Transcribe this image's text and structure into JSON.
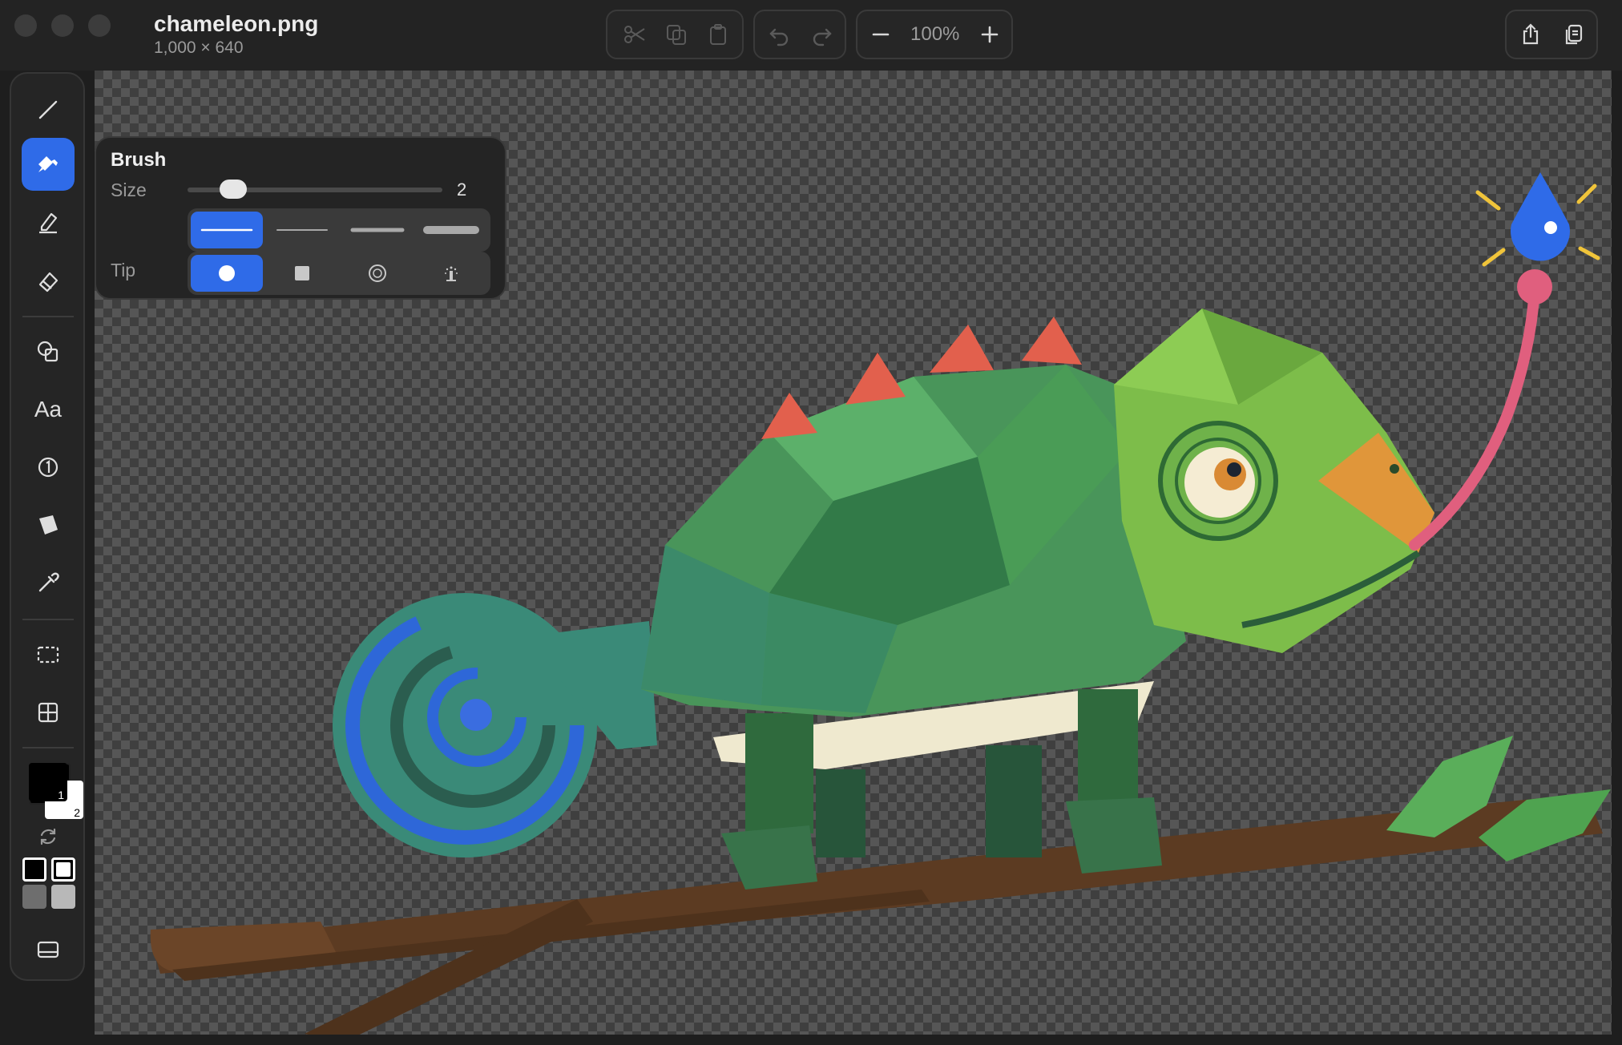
{
  "window": {
    "title": "chameleon.png",
    "dimensions": "1,000 × 640"
  },
  "toolbar_top": {
    "zoom_level": "100%",
    "icons": [
      "scissors-icon",
      "copy-icon",
      "paste-icon",
      "undo-icon",
      "redo-icon",
      "zoom-out-icon",
      "zoom-in-icon",
      "share-icon",
      "duplicate-icon"
    ]
  },
  "tools": {
    "items": [
      "pen",
      "brush",
      "highlighter",
      "eraser",
      "shapes",
      "text",
      "number",
      "fill",
      "eyedropper",
      "select",
      "grid"
    ],
    "active": "brush",
    "text_tool_label": "Aa",
    "number_tool_label": "1"
  },
  "brush_panel": {
    "title": "Brush",
    "size_label": "Size",
    "size_value": "2",
    "size_fraction": 0.14,
    "tip_label": "Tip",
    "stroke_styles": [
      "smooth",
      "thin",
      "medium",
      "thick"
    ],
    "selected_stroke": 0,
    "tips": [
      "round",
      "square",
      "ring",
      "spray"
    ],
    "selected_tip": 0
  },
  "colors": {
    "primary_label": "1",
    "secondary_label": "2",
    "primary": "#000000",
    "secondary": "#ffffff",
    "accent": "#2f6be8"
  }
}
